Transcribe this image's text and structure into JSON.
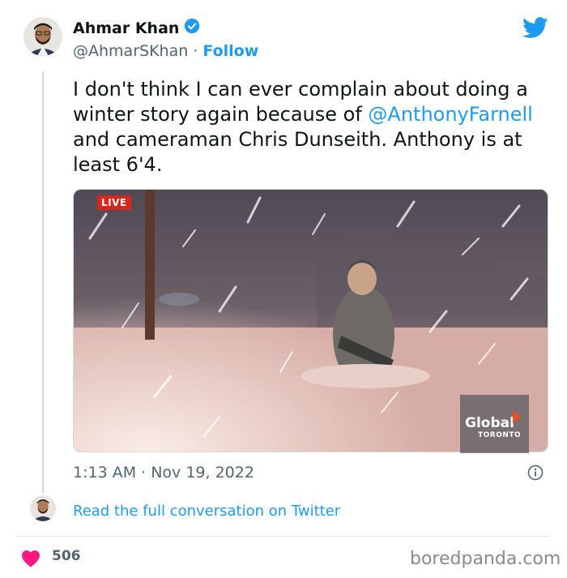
{
  "author": {
    "name": "Ahmar Khan",
    "handle": "@AhmarSKhan",
    "separator": "·",
    "follow_label": "Follow"
  },
  "tweet": {
    "text_before": "I don't think I can ever complain about doing a winter story again because of ",
    "mention": "@AnthonyFarnell",
    "text_after": " and cameraman Chris Dunseith. Anthony is at least 6'4."
  },
  "media": {
    "live_label": "LIVE",
    "logo_text": "Global",
    "logo_sub": "TORONTO"
  },
  "meta": {
    "timestamp": "1:13 AM · Nov 19, 2022"
  },
  "conversation": {
    "link_label": "Read the full conversation on Twitter"
  },
  "engagement": {
    "likes": "506"
  },
  "watermark": "boredpanda.com",
  "colors": {
    "accent": "#1d9bf0",
    "heart": "#f91880",
    "live": "#d8261e"
  },
  "icons": [
    "verified-badge-icon",
    "twitter-bird-icon",
    "info-icon",
    "heart-icon"
  ]
}
